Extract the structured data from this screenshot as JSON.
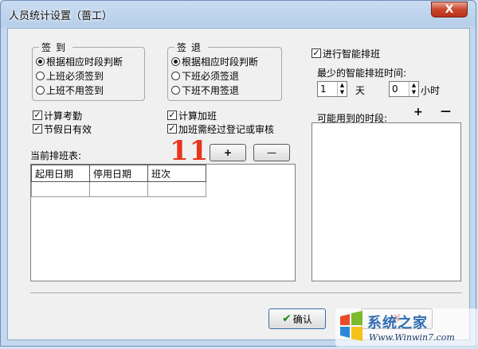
{
  "window": {
    "title": "人员统计设置（蔷工）",
    "close_symbol": "X"
  },
  "checkin": {
    "title": "签到",
    "options": [
      "根据相应时段判断",
      "上班必须签到",
      "上班不用签到"
    ],
    "selected": 0
  },
  "checkout": {
    "title": "签退",
    "options": [
      "根据相应时段判断",
      "下班必须签退",
      "下班不用签退"
    ],
    "selected": 0
  },
  "checks": {
    "attendance": "计算考勤",
    "holiday": "节假日有效",
    "overtime": "计算加班",
    "overtime_review": "加班需经过登记或审核"
  },
  "schedule": {
    "label": "当前排班表:",
    "columns": [
      "起用日期",
      "停用日期",
      "班次"
    ],
    "add_button": "+",
    "remove_button": "—"
  },
  "smart": {
    "enable_label": "进行智能排班",
    "min_time_label": "最少的智能排班时间:",
    "days_value": "1",
    "days_unit": "天",
    "hours_value": "0",
    "hours_unit": "小时",
    "periods_label": "可能用到的时段:",
    "add_symbol": "+",
    "remove_symbol": "—"
  },
  "footer": {
    "confirm_label": "确认",
    "confirm_icon": "check-icon"
  },
  "annotation": {
    "number": "11"
  },
  "watermark": {
    "brand": "系统之家",
    "url": "Www.Winwin7.com"
  }
}
